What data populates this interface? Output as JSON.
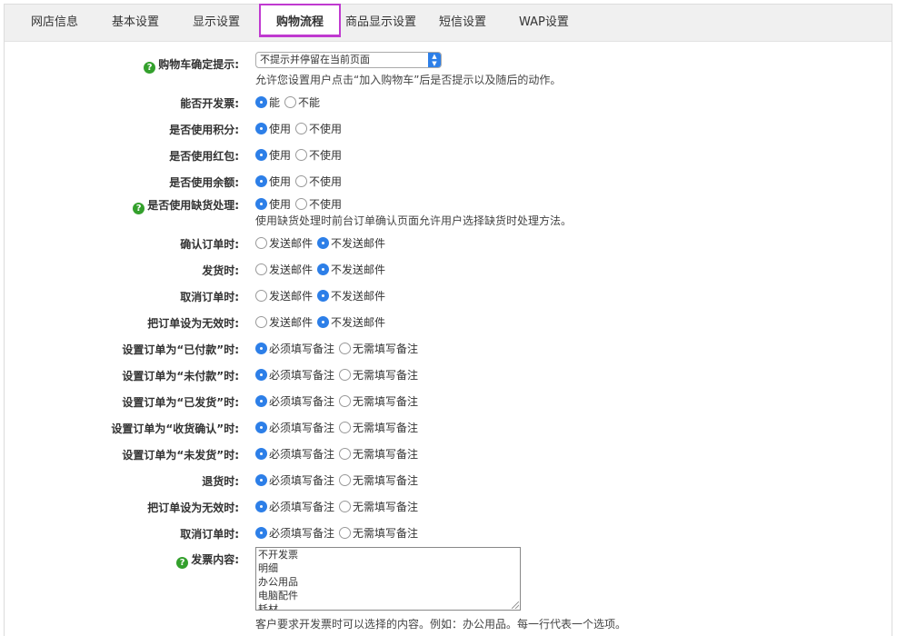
{
  "tabs": [
    {
      "label": "网店信息"
    },
    {
      "label": "基本设置"
    },
    {
      "label": "显示设置"
    },
    {
      "label": "购物流程"
    },
    {
      "label": "商品显示设置"
    },
    {
      "label": "短信设置"
    },
    {
      "label": "WAP设置"
    }
  ],
  "active_tab": "购物流程",
  "cart_prompt": {
    "label": "购物车确定提示:",
    "selected": "不提示并停留在当前页面",
    "note": "允许您设置用户点击“加入购物车”后是否提示以及随后的动作。"
  },
  "settings": [
    {
      "label": "能否开发票:",
      "options": [
        "能",
        "不能"
      ],
      "selected": 0
    },
    {
      "label": "是否使用积分:",
      "options": [
        "使用",
        "不使用"
      ],
      "selected": 0
    },
    {
      "label": "是否使用红包:",
      "options": [
        "使用",
        "不使用"
      ],
      "selected": 0
    },
    {
      "label": "是否使用余额:",
      "options": [
        "使用",
        "不使用"
      ],
      "selected": 0
    },
    {
      "label": "是否使用缺货处理:",
      "options": [
        "使用",
        "不使用"
      ],
      "selected": 0,
      "help": true,
      "note": "使用缺货处理时前台订单确认页面允许用户选择缺货时处理方法。"
    },
    {
      "label": "确认订单时:",
      "options": [
        "发送邮件",
        "不发送邮件"
      ],
      "selected": 1
    },
    {
      "label": "发货时:",
      "options": [
        "发送邮件",
        "不发送邮件"
      ],
      "selected": 1
    },
    {
      "label": "取消订单时:",
      "options": [
        "发送邮件",
        "不发送邮件"
      ],
      "selected": 1
    },
    {
      "label": "把订单设为无效时:",
      "options": [
        "发送邮件",
        "不发送邮件"
      ],
      "selected": 1
    },
    {
      "label": "设置订单为“已付款”时:",
      "options": [
        "必须填写备注",
        "无需填写备注"
      ],
      "selected": 0
    },
    {
      "label": "设置订单为“未付款”时:",
      "options": [
        "必须填写备注",
        "无需填写备注"
      ],
      "selected": 0
    },
    {
      "label": "设置订单为“已发货”时:",
      "options": [
        "必须填写备注",
        "无需填写备注"
      ],
      "selected": 0
    },
    {
      "label": "设置订单为“收货确认”时:",
      "options": [
        "必须填写备注",
        "无需填写备注"
      ],
      "selected": 0
    },
    {
      "label": "设置订单为“未发货”时:",
      "options": [
        "必须填写备注",
        "无需填写备注"
      ],
      "selected": 0
    },
    {
      "label": "退货时:",
      "options": [
        "必须填写备注",
        "无需填写备注"
      ],
      "selected": 0
    },
    {
      "label": "把订单设为无效时:",
      "options": [
        "必须填写备注",
        "无需填写备注"
      ],
      "selected": 0
    },
    {
      "label": "取消订单时:",
      "options": [
        "必须填写备注",
        "无需填写备注"
      ],
      "selected": 0
    }
  ],
  "invoice": {
    "label": "发票内容:",
    "lines": [
      "不开发票",
      "明细",
      "办公用品",
      "电脑配件",
      "耗材"
    ],
    "note": "客户要求开发票时可以选择的内容。例如：办公用品。每一行代表一个选项。"
  },
  "colors": {
    "accent": "#2d7fe8",
    "active_tab_border": "#c03ad0",
    "help": "#33a02c"
  },
  "icons": {
    "help": "question-circle-icon",
    "select_arrow": "updown-arrow-icon",
    "textarea_grip": "resize-grip-icon"
  }
}
